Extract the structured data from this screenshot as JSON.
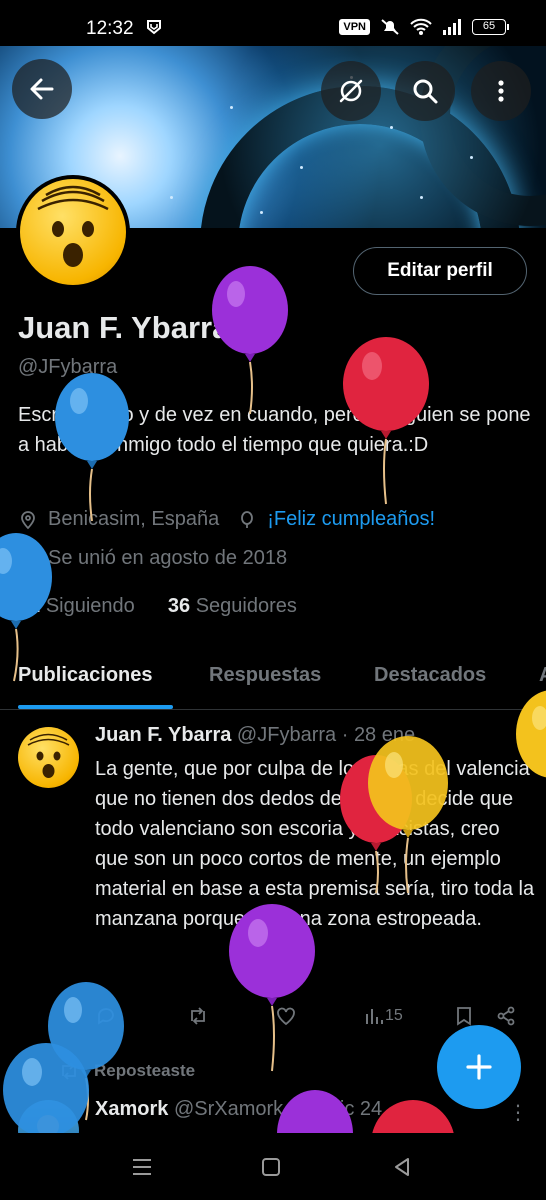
{
  "status_bar": {
    "time": "12:32",
    "vpn": "VPN",
    "battery": "65"
  },
  "header": {
    "back_icon": "arrow-left-icon",
    "grok_icon": "grok-icon",
    "search_icon": "search-icon",
    "more_icon": "more-vertical-icon"
  },
  "profile": {
    "edit_label": "Editar perfil",
    "name": "Juan F. Ybarra",
    "handle": "@JFybarra",
    "bio": "Escribo poco y de vez en cuando, pero si alguien se pone a hablar conmigo todo el tiempo que quiera.:D",
    "location": "Benicasim, España",
    "birthday": "¡Feliz cumpleaños!",
    "joined": "Se unió en agosto de 2018",
    "following_count": "82",
    "following_label": "Siguiendo",
    "followers_count": "36",
    "followers_label": "Seguidores"
  },
  "tabs": [
    "Publicaciones",
    "Respuestas",
    "Destacados",
    "A"
  ],
  "tweet": {
    "name": "Juan F. Ybarra",
    "handle": "@JFybarra",
    "dot": "·",
    "date": "28 ene",
    "text": "La gente, que por culpa de los ultras del valencia que no tienen dos dedos de frente , decide que todo valenciano son escoria y/o racistas, creo que son un poco cortos de mente, un ejemplo material en base a esta premisa sería, tiro toda la manzana porque hay una zona estropeada.",
    "views": "15"
  },
  "repost": {
    "label": "Reposteaste",
    "name": "Xamork",
    "handle": "@SrXamork",
    "dot": "·",
    "date": "08 dic 24"
  },
  "colors": {
    "accent": "#1d9bf0",
    "muted": "#71767b",
    "text": "#e7e9ea",
    "background": "#000000"
  }
}
